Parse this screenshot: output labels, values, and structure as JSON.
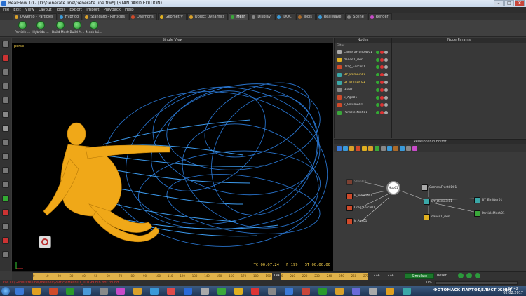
{
  "window": {
    "title": "RealFlow 10 - [D:\\Generate line\\Generate line.flw*] (STANDARD EDITION)",
    "controls": [
      "–",
      "□",
      "✕"
    ]
  },
  "menu": [
    "File",
    "Edit",
    "View",
    "Layout",
    "Tools",
    "Export",
    "Import",
    "Playback",
    "Help"
  ],
  "shelf_tabs": [
    {
      "label": "Dyverso - Particles",
      "color": "#d9a12a"
    },
    {
      "label": "Hybrido",
      "color": "#3a9ad9"
    },
    {
      "label": "Standard - Particles",
      "color": "#d9a12a"
    },
    {
      "label": "Daemons",
      "color": "#d04a2a"
    },
    {
      "label": "Geometry",
      "color": "#e0b020"
    },
    {
      "label": "Object Dynamics",
      "color": "#d9a12a"
    },
    {
      "label": "Mesh",
      "color": "#3aa83a"
    },
    {
      "label": "Display",
      "color": "#888888"
    },
    {
      "label": "IDOC",
      "color": "#3a9ad9"
    },
    {
      "label": "Tools",
      "color": "#aa6a2a"
    },
    {
      "label": "RealWave",
      "color": "#3a9ad9"
    },
    {
      "label": "Spline",
      "color": "#888888"
    },
    {
      "label": "Render",
      "color": "#c84ac8"
    }
  ],
  "active_shelf_tab": 6,
  "toolbar": [
    "Particle ...",
    "Hybrido ...",
    "Build Mesh",
    "Build M...",
    "Mesh Ini..."
  ],
  "viewport": {
    "title": "Single View",
    "label": "persp",
    "status": {
      "timecode": "TC 00:07:24",
      "frame": "F 199",
      "simtime": "ST 00:00:00"
    }
  },
  "nodes_panel": {
    "title": "Nodes",
    "filter_label": "Filter",
    "items": [
      {
        "name": "CameraFront0D01",
        "color": "#aaaaaa"
      },
      {
        "name": "dance1_skin",
        "color": "#e0b020"
      },
      {
        "name": "Drag_Force01",
        "color": "#d04a2a"
      },
      {
        "name": "DY_Domain01",
        "color": "#3aa8a8"
      },
      {
        "name": "DY_Emitter01",
        "color": "#3aa8a8"
      },
      {
        "name": "Hub01",
        "color": "#888888"
      },
      {
        "name": "k_Age01",
        "color": "#d04a2a"
      },
      {
        "name": "k_Volume01",
        "color": "#d04a2a"
      },
      {
        "name": "ParticleMesh01",
        "color": "#3aa83a"
      }
    ]
  },
  "params_panel": {
    "title": "Node Params"
  },
  "relationship_editor": {
    "title": "Relationship Editor",
    "hub_label": "Hub01",
    "nodes": {
      "faded": "Sheets01",
      "k_volume": "k_Volume01",
      "drag_force": "Drag_Force01",
      "k_age": "k_Age01",
      "camera": "CameraFront0D01",
      "domain": "DY_Domain01",
      "emitter": "DY_Emitter01",
      "skin": "dance1_skin",
      "mesh": "ParticleMesh01"
    }
  },
  "timeline": {
    "ticks": [
      "0",
      "10",
      "20",
      "30",
      "40",
      "50",
      "60",
      "70",
      "80",
      "90",
      "100",
      "110",
      "120",
      "130",
      "140",
      "150",
      "160",
      "170",
      "180",
      "190",
      "200",
      "210",
      "220",
      "230",
      "240",
      "250",
      "260",
      "270"
    ],
    "current_frame": "199",
    "end_a": "274",
    "end_b": "274",
    "simulate_label": "Simulate",
    "reset_label": "Reset"
  },
  "status": {
    "message": "File D:\\Generate line\\meshes\\ParticleMesh01_00199.bin not found.",
    "progress_label": "0%",
    "progress": 0
  },
  "taskbar": {
    "overlay_text": "ФОТОМАСК ПАРТОДЕЛИСТ ЖНИГ",
    "time": "17:42",
    "date": "02.02.2017"
  }
}
